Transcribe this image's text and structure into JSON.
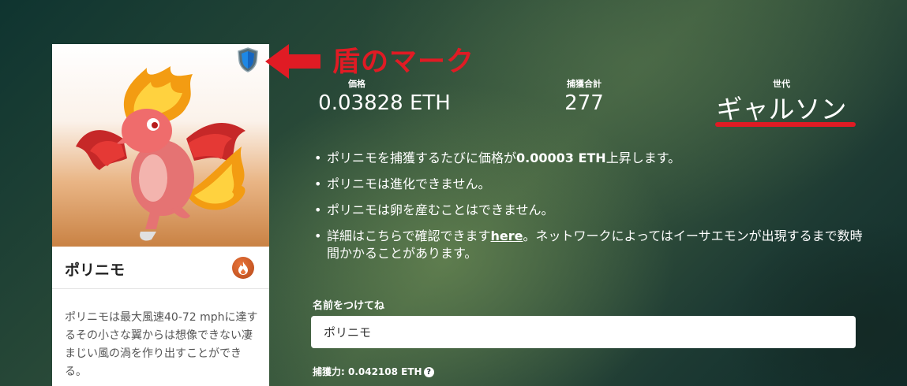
{
  "card": {
    "name": "ポリニモ",
    "type_icon": "fire-icon",
    "description": "ポリニモは最大風速40-72 mphに達するその小さな翼からは想像できない凄まじい風の渦を作り出すことができる。"
  },
  "annotation": {
    "shield_icon": "shield-icon",
    "label": "盾のマーク",
    "color": "#e01b24"
  },
  "stats": {
    "price": {
      "label": "価格",
      "value": "0.03828 ETH"
    },
    "catch_total": {
      "label": "捕獲合計",
      "value": "277"
    },
    "generation": {
      "label": "世代",
      "value": "ギャルソン"
    }
  },
  "bullets": {
    "b1_pre": "ポリニモを捕獲するたびに価格が",
    "b1_bold": "0.00003 ETH",
    "b1_post": "上昇します。",
    "b2": "ポリニモは進化できません。",
    "b3": "ポリニモは卵を産むことはできません。",
    "b4_pre": "詳細はこちらで確認できます",
    "b4_link": "here",
    "b4_post": "。ネットワークによってはイーサエモンが出現するまで数時間かかることがあります。"
  },
  "form": {
    "name_label": "名前をつけてね",
    "name_value": "ポリニモ"
  },
  "power": {
    "text": "捕獲力: 0.042108 ETH",
    "help_icon": "?"
  }
}
